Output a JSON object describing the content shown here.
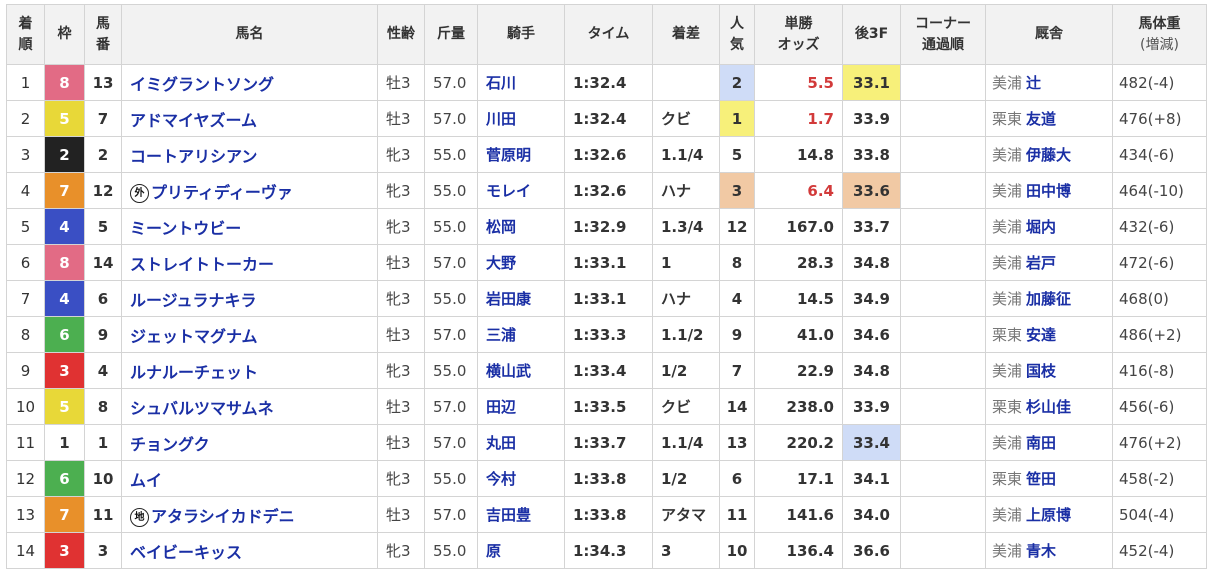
{
  "headers": {
    "rank": "着順",
    "waku": "枠",
    "num": "馬番",
    "horse": "馬名",
    "sex_age": "性齢",
    "weight": "斤量",
    "jockey": "騎手",
    "time": "タイム",
    "margin": "着差",
    "popularity": "人気",
    "odds": "単勝オッズ",
    "last3f": "後3F",
    "corner": "コーナー通過順",
    "stable": "厩舎",
    "body_weight": "馬体重",
    "body_weight_sub": "(増減)"
  },
  "waku_colors": {
    "1": {
      "bg": "#ffffff",
      "fg": "#333333"
    },
    "2": {
      "bg": "#222222",
      "fg": "#ffffff"
    },
    "3": {
      "bg": "#e03232",
      "fg": "#ffffff"
    },
    "4": {
      "bg": "#3a4fc4",
      "fg": "#ffffff"
    },
    "5": {
      "bg": "#e8d838",
      "fg": "#ffffff"
    },
    "6": {
      "bg": "#4caf50",
      "fg": "#ffffff"
    },
    "7": {
      "bg": "#e8902a",
      "fg": "#ffffff"
    },
    "8": {
      "bg": "#e26b85",
      "fg": "#ffffff"
    }
  },
  "highlight_colors": {
    "gold": "#f7f07a",
    "silver": "#cfdcf7",
    "bronze": "#f1c9a4"
  },
  "rows": [
    {
      "rank": "1",
      "waku": "8",
      "num": "13",
      "mark": "",
      "horse": "イミグラントソング",
      "sex_age": "牡3",
      "weight": "57.0",
      "jockey": "石川",
      "time": "1:32.4",
      "margin": "",
      "popularity": "2",
      "odds": "5.5",
      "last3f": "33.1",
      "corner": "",
      "stable_loc": "美浦",
      "trainer": "辻",
      "body_weight": "482(-4)",
      "pop_hl": "silver",
      "last3f_hl": "gold",
      "odds_red": true
    },
    {
      "rank": "2",
      "waku": "5",
      "num": "7",
      "mark": "",
      "horse": "アドマイヤズーム",
      "sex_age": "牡3",
      "weight": "57.0",
      "jockey": "川田",
      "time": "1:32.4",
      "margin": "クビ",
      "popularity": "1",
      "odds": "1.7",
      "last3f": "33.9",
      "corner": "",
      "stable_loc": "栗東",
      "trainer": "友道",
      "body_weight": "476(+8)",
      "pop_hl": "gold",
      "last3f_hl": "",
      "odds_red": true
    },
    {
      "rank": "3",
      "waku": "2",
      "num": "2",
      "mark": "",
      "horse": "コートアリシアン",
      "sex_age": "牝3",
      "weight": "55.0",
      "jockey": "菅原明",
      "time": "1:32.6",
      "margin": "1.1/4",
      "popularity": "5",
      "odds": "14.8",
      "last3f": "33.8",
      "corner": "",
      "stable_loc": "美浦",
      "trainer": "伊藤大",
      "body_weight": "434(-6)",
      "pop_hl": "",
      "last3f_hl": "",
      "odds_red": false
    },
    {
      "rank": "4",
      "waku": "7",
      "num": "12",
      "mark": "外",
      "horse": "プリティディーヴァ",
      "sex_age": "牝3",
      "weight": "55.0",
      "jockey": "モレイ",
      "time": "1:32.6",
      "margin": "ハナ",
      "popularity": "3",
      "odds": "6.4",
      "last3f": "33.6",
      "corner": "",
      "stable_loc": "美浦",
      "trainer": "田中博",
      "body_weight": "464(-10)",
      "pop_hl": "bronze",
      "last3f_hl": "bronze",
      "odds_red": true
    },
    {
      "rank": "5",
      "waku": "4",
      "num": "5",
      "mark": "",
      "horse": "ミーントウビー",
      "sex_age": "牝3",
      "weight": "55.0",
      "jockey": "松岡",
      "time": "1:32.9",
      "margin": "1.3/4",
      "popularity": "12",
      "odds": "167.0",
      "last3f": "33.7",
      "corner": "",
      "stable_loc": "美浦",
      "trainer": "堀内",
      "body_weight": "432(-6)",
      "pop_hl": "",
      "last3f_hl": "",
      "odds_red": false
    },
    {
      "rank": "6",
      "waku": "8",
      "num": "14",
      "mark": "",
      "horse": "ストレイトトーカー",
      "sex_age": "牡3",
      "weight": "57.0",
      "jockey": "大野",
      "time": "1:33.1",
      "margin": "1",
      "popularity": "8",
      "odds": "28.3",
      "last3f": "34.8",
      "corner": "",
      "stable_loc": "美浦",
      "trainer": "岩戸",
      "body_weight": "472(-6)",
      "pop_hl": "",
      "last3f_hl": "",
      "odds_red": false
    },
    {
      "rank": "7",
      "waku": "4",
      "num": "6",
      "mark": "",
      "horse": "ルージュラナキラ",
      "sex_age": "牝3",
      "weight": "55.0",
      "jockey": "岩田康",
      "time": "1:33.1",
      "margin": "ハナ",
      "popularity": "4",
      "odds": "14.5",
      "last3f": "34.9",
      "corner": "",
      "stable_loc": "美浦",
      "trainer": "加藤征",
      "body_weight": "468(0)",
      "pop_hl": "",
      "last3f_hl": "",
      "odds_red": false
    },
    {
      "rank": "8",
      "waku": "6",
      "num": "9",
      "mark": "",
      "horse": "ジェットマグナム",
      "sex_age": "牡3",
      "weight": "57.0",
      "jockey": "三浦",
      "time": "1:33.3",
      "margin": "1.1/2",
      "popularity": "9",
      "odds": "41.0",
      "last3f": "34.6",
      "corner": "",
      "stable_loc": "栗東",
      "trainer": "安達",
      "body_weight": "486(+2)",
      "pop_hl": "",
      "last3f_hl": "",
      "odds_red": false
    },
    {
      "rank": "9",
      "waku": "3",
      "num": "4",
      "mark": "",
      "horse": "ルナルーチェット",
      "sex_age": "牝3",
      "weight": "55.0",
      "jockey": "横山武",
      "time": "1:33.4",
      "margin": "1/2",
      "popularity": "7",
      "odds": "22.9",
      "last3f": "34.8",
      "corner": "",
      "stable_loc": "美浦",
      "trainer": "国枝",
      "body_weight": "416(-8)",
      "pop_hl": "",
      "last3f_hl": "",
      "odds_red": false
    },
    {
      "rank": "10",
      "waku": "5",
      "num": "8",
      "mark": "",
      "horse": "シュバルツマサムネ",
      "sex_age": "牡3",
      "weight": "57.0",
      "jockey": "田辺",
      "time": "1:33.5",
      "margin": "クビ",
      "popularity": "14",
      "odds": "238.0",
      "last3f": "33.9",
      "corner": "",
      "stable_loc": "栗東",
      "trainer": "杉山佳",
      "body_weight": "456(-6)",
      "pop_hl": "",
      "last3f_hl": "",
      "odds_red": false
    },
    {
      "rank": "11",
      "waku": "1",
      "num": "1",
      "mark": "",
      "horse": "チョングク",
      "sex_age": "牡3",
      "weight": "57.0",
      "jockey": "丸田",
      "time": "1:33.7",
      "margin": "1.1/4",
      "popularity": "13",
      "odds": "220.2",
      "last3f": "33.4",
      "corner": "",
      "stable_loc": "美浦",
      "trainer": "南田",
      "body_weight": "476(+2)",
      "pop_hl": "",
      "last3f_hl": "silver",
      "odds_red": false
    },
    {
      "rank": "12",
      "waku": "6",
      "num": "10",
      "mark": "",
      "horse": "ムイ",
      "sex_age": "牝3",
      "weight": "55.0",
      "jockey": "今村",
      "time": "1:33.8",
      "margin": "1/2",
      "popularity": "6",
      "odds": "17.1",
      "last3f": "34.1",
      "corner": "",
      "stable_loc": "栗東",
      "trainer": "笹田",
      "body_weight": "458(-2)",
      "pop_hl": "",
      "last3f_hl": "",
      "odds_red": false
    },
    {
      "rank": "13",
      "waku": "7",
      "num": "11",
      "mark": "地",
      "horse": "アタラシイカドデニ",
      "sex_age": "牡3",
      "weight": "57.0",
      "jockey": "吉田豊",
      "time": "1:33.8",
      "margin": "アタマ",
      "popularity": "11",
      "odds": "141.6",
      "last3f": "34.0",
      "corner": "",
      "stable_loc": "美浦",
      "trainer": "上原博",
      "body_weight": "504(-4)",
      "pop_hl": "",
      "last3f_hl": "",
      "odds_red": false
    },
    {
      "rank": "14",
      "waku": "3",
      "num": "3",
      "mark": "",
      "horse": "ベイビーキッス",
      "sex_age": "牝3",
      "weight": "55.0",
      "jockey": "原",
      "time": "1:34.3",
      "margin": "3",
      "popularity": "10",
      "odds": "136.4",
      "last3f": "36.6",
      "corner": "",
      "stable_loc": "美浦",
      "trainer": "青木",
      "body_weight": "452(-4)",
      "pop_hl": "",
      "last3f_hl": "",
      "odds_red": false
    }
  ]
}
